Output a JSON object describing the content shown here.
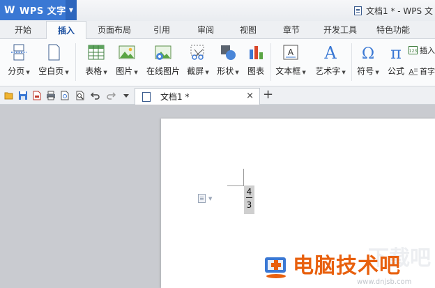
{
  "app": {
    "name": "WPS 文字",
    "logo": "W"
  },
  "window": {
    "title": "文档1 * - WPS 文"
  },
  "ribbon_tabs": [
    "开始",
    "插入",
    "页面布局",
    "引用",
    "审阅",
    "视图",
    "章节",
    "开发工具",
    "特色功能"
  ],
  "active_tab": "插入",
  "ribbon_buttons": {
    "page_break": "分页",
    "blank_page": "空白页",
    "table": "表格",
    "picture": "图片",
    "online_picture": "在线图片",
    "screenshot": "截屏",
    "shape": "形状",
    "chart": "图表",
    "textbox": "文本框",
    "wordart": "艺术字",
    "symbol": "符号",
    "formula": "公式",
    "insert_number": "插入",
    "dropcap": "首字"
  },
  "icons": {
    "symbol_glyph": "Ω",
    "formula_glyph": "π",
    "wordart_glyph": "A",
    "number_glyph": "123"
  },
  "doc_tab": {
    "name": "文档1 *",
    "close": "×",
    "new": "+"
  },
  "document": {
    "numerator": "4",
    "denominator": "3"
  },
  "watermark": {
    "text": "电脑技术吧",
    "sub": "www.dnjsb.com",
    "ghost": "下载吧"
  },
  "colors": {
    "accent": "#3a78d4",
    "watermark": "#e8600e"
  }
}
